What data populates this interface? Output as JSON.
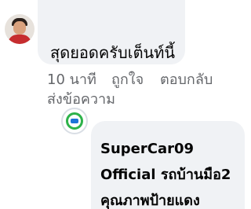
{
  "comment": {
    "text": "สุดยอดครับเต็นท์นี้",
    "time": "10 นาที",
    "like_label": "ถูกใจ",
    "reply_label": "ตอบกลับ",
    "send_message_label": "ส่งข้อความ"
  },
  "reply": {
    "author": "SuperCar09 Official",
    "text": "รถบ้านมือ2 คุณภาพป้ายแดง"
  },
  "colors": {
    "bubble": "#f0f2f5",
    "secondary_text": "#65676b",
    "primary_text": "#050505"
  }
}
